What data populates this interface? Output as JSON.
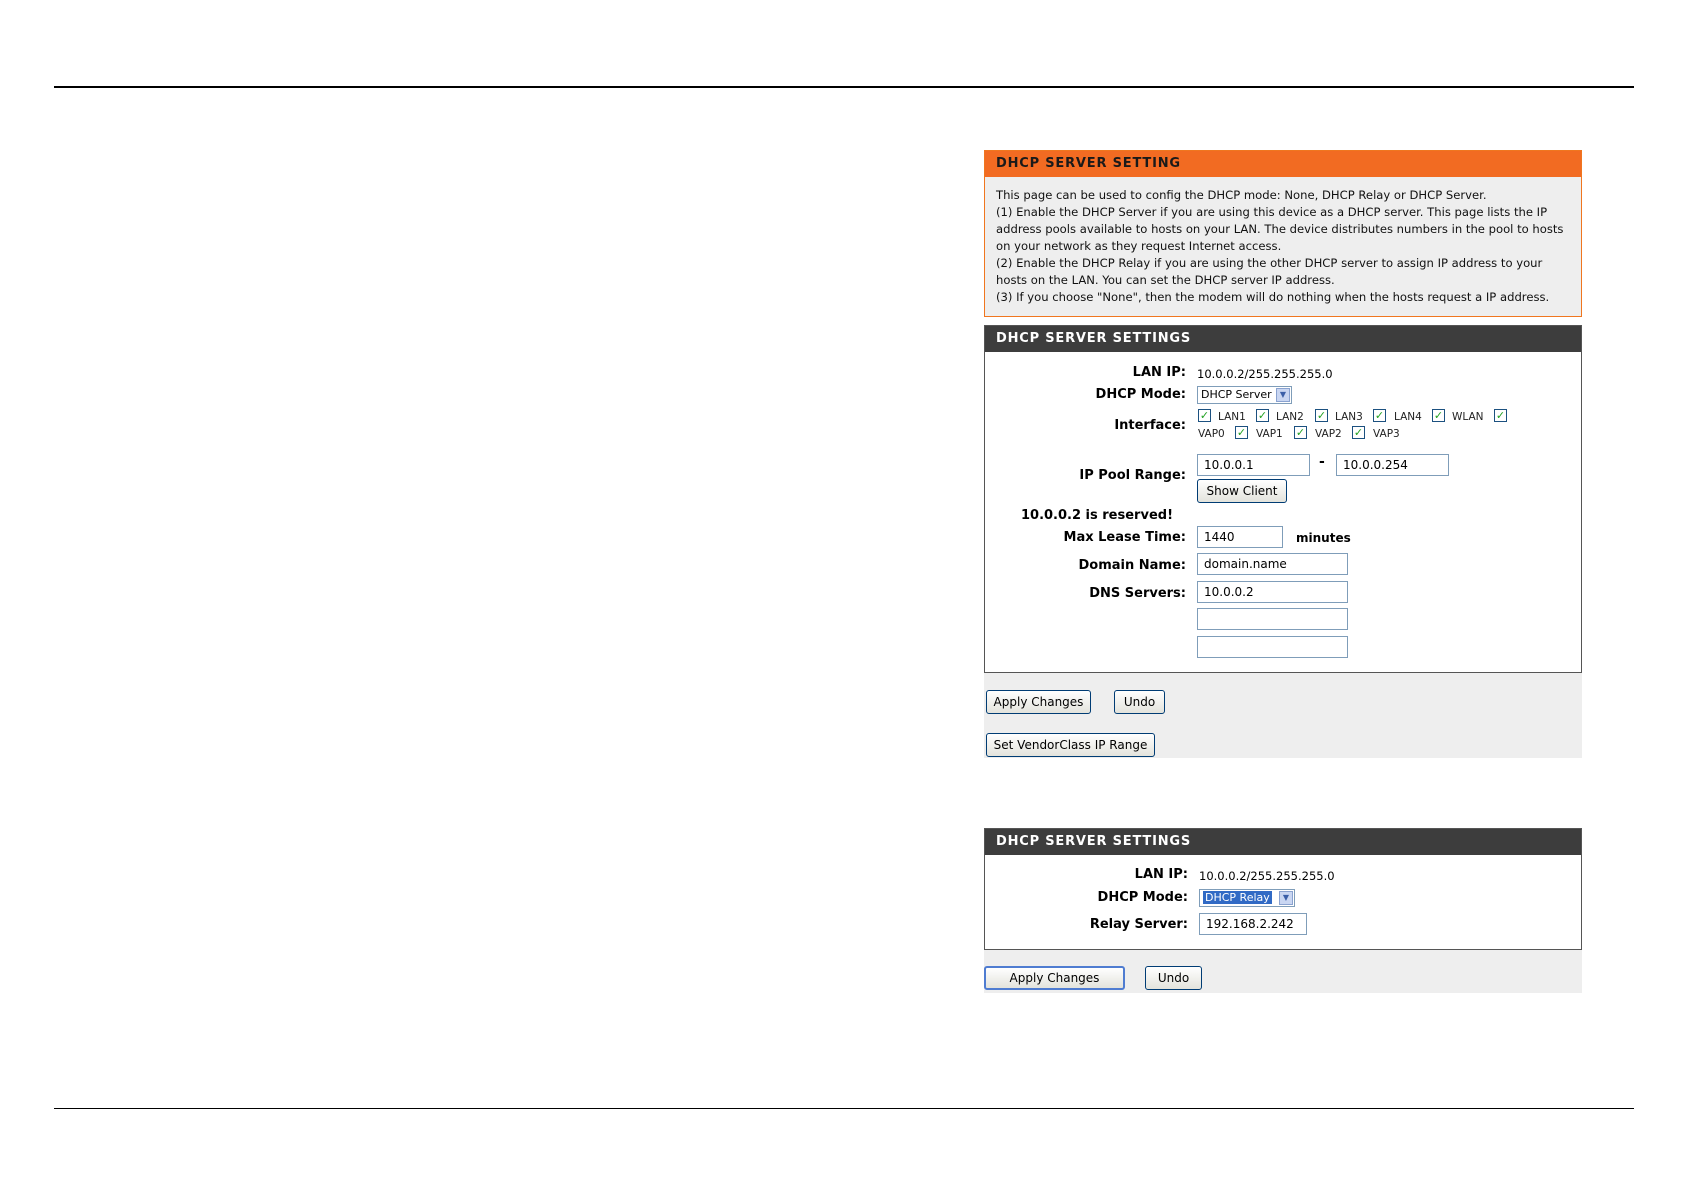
{
  "info": {
    "title": "DHCP SERVER SETTING",
    "lines": [
      "This page can be used to config the DHCP mode: None, DHCP Relay or DHCP Server.",
      "(1) Enable the DHCP Server if you are using this device as a DHCP server. This page lists the IP",
      "address pools available to hosts on your LAN. The device distributes numbers in the pool to hosts",
      "on your network as they request Internet access.",
      "(2) Enable the DHCP Relay if you are using the other DHCP server to assign IP address to your",
      "hosts on the LAN. You can set the DHCP server IP address.",
      "(3) If you choose \"None\", then the modem will do nothing when the hosts request a IP address."
    ]
  },
  "server_panel": {
    "title": "DHCP SERVER SETTINGS",
    "lan_ip_label": "LAN IP:",
    "lan_ip_value": "10.0.0.2/255.255.255.0",
    "dhcp_mode_label": "DHCP Mode:",
    "dhcp_mode_value": "DHCP Server",
    "interface_label": "Interface:",
    "interfaces": [
      "LAN1",
      "LAN2",
      "LAN3",
      "LAN4",
      "WLAN",
      "VAP0",
      "VAP1",
      "VAP2",
      "VAP3"
    ],
    "ip_pool_label": "IP Pool Range:",
    "ip_pool_start": "10.0.0.1",
    "ip_pool_dash": "-",
    "ip_pool_end": "10.0.0.254",
    "show_client_label": "Show Client",
    "reserved_text": "10.0.0.2 is reserved!",
    "max_lease_label": "Max Lease Time:",
    "max_lease_value": "1440",
    "minutes_label": "minutes",
    "domain_name_label": "Domain Name:",
    "domain_name_value": "domain.name",
    "dns_label": "DNS Servers:",
    "dns_values": [
      "10.0.0.2",
      "",
      ""
    ],
    "apply_label": "Apply Changes",
    "undo_label": "Undo",
    "vendorclass_label": "Set VendorClass IP Range"
  },
  "relay_panel": {
    "title": "DHCP SERVER SETTINGS",
    "lan_ip_label": "LAN IP:",
    "lan_ip_value": "10.0.0.2/255.255.255.0",
    "dhcp_mode_label": "DHCP Mode:",
    "dhcp_mode_value": "DHCP Relay",
    "relay_server_label": "Relay Server:",
    "relay_server_value": "192.168.2.242",
    "apply_label": "Apply Changes",
    "undo_label": "Undo"
  },
  "colors": {
    "orange_header": "#f26b22",
    "dark_header": "#3d3d3d",
    "panel_background": "#eeeeee"
  }
}
